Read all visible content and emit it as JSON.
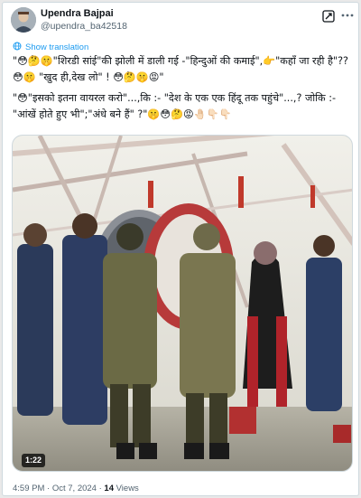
{
  "author": {
    "name": "Upendra Bajpai",
    "handle": "@upendra_ba42518"
  },
  "translate": {
    "label": "Show translation"
  },
  "tweet": {
    "paragraph1": "\"😳🤔🤫\"शिरडी सांई\"की झोली में डाली गई -\"हिन्दुओं की कमाई\",👉\"कहाँ जा रही है\"??😳🤫 \"खुद ही,देख लो\" ! 😳🤔🤫😡\"",
    "paragraph2": "\"😳\"इसको इतना वायरल करो\"...,कि :- \"देश के एक एक हिंदू तक पहुंचे\"...,? जोकि :- \"आंखें होते हुए भी\";\"अंधे बने हैं\" ?\"🤫😳🤔😡🤚🏻👇🏻👇🏻"
  },
  "video": {
    "duration": "1:22"
  },
  "meta": {
    "time": "4:59 PM",
    "date": "Oct 7, 2024",
    "views_count": "14",
    "views_label": "Views"
  },
  "icons": {
    "grok": "grok-icon",
    "more": "more-options-icon",
    "translate": "globe-icon"
  },
  "colors": {
    "link": "#1d9bf0",
    "secondary_text": "#536471",
    "primary_text": "#0f1419"
  }
}
